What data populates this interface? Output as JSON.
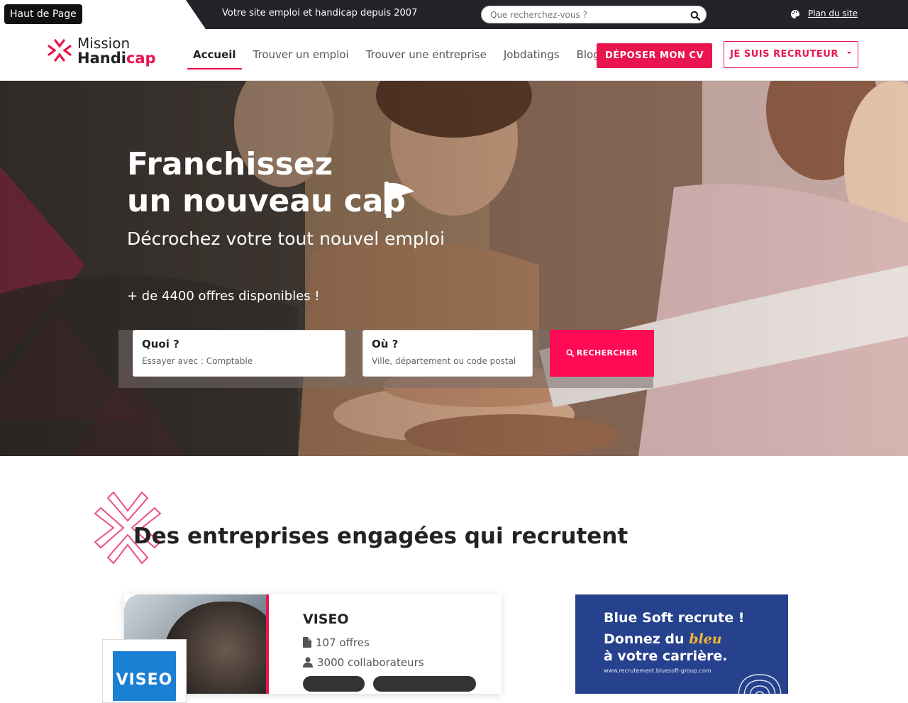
{
  "skip_link": "Haut de Page",
  "topbar": {
    "tagline": "Votre site emploi et handicap depuis 2007",
    "search_placeholder": "Que recherchez-vous ?",
    "sitemap": "Plan du site"
  },
  "logo": {
    "line1": "Mission",
    "line2_a": "Handi",
    "line2_b": "cap"
  },
  "nav": {
    "items": [
      {
        "label": "Accueil",
        "active": true
      },
      {
        "label": "Trouver un emploi"
      },
      {
        "label": "Trouver une entreprise"
      },
      {
        "label": "Jobdatings"
      },
      {
        "label": "Blog"
      }
    ],
    "cta_cv": "DÉPOSER MON CV",
    "cta_recruiter": "JE SUIS RECRUTEUR"
  },
  "hero": {
    "title_line1": "Franchissez",
    "title_line2": "un nouveau cap",
    "subtitle": "Décrochez votre tout nouvel emploi",
    "count": "+ de 4400 offres disponibles !",
    "what_label": "Quoi ?",
    "what_placeholder": "Essayer avec : Comptable",
    "where_label": "Où ?",
    "where_placeholder": "Ville, département ou code postal",
    "search_button": "RECHERCHER"
  },
  "section": {
    "title": "Des entreprises engagées qui recrutent"
  },
  "company_card": {
    "name": "VISEO",
    "offers": "107 offres",
    "staff": "3000 collaborateurs",
    "logo_text": "VISEO"
  },
  "ad": {
    "title": "Blue Soft recrute !",
    "line2_a": "Donnez du ",
    "line2_b": "bleu",
    "line3": "à votre carrière.",
    "url": "www.recrutement.bluesoft-group.com"
  },
  "colors": {
    "accent": "#e8154f",
    "search_button": "#ff0a54",
    "topbar": "#23232a",
    "ad_bg": "#26418d"
  }
}
